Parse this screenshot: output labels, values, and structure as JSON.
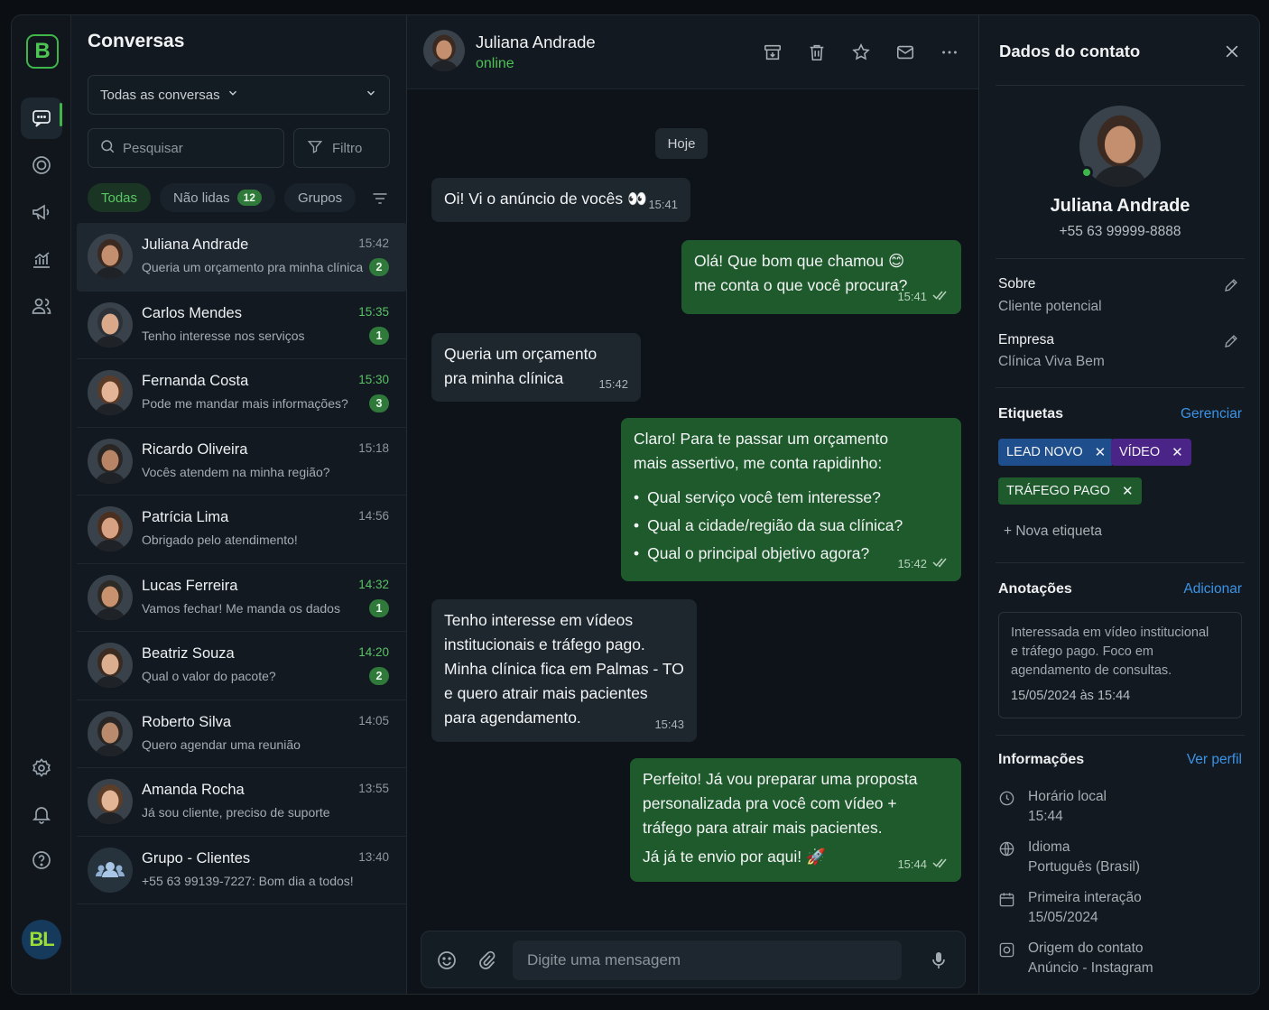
{
  "rail": {
    "logo": "B",
    "user_initials": "BL"
  },
  "list": {
    "title": "Conversas",
    "select_value": "Todas as conversas",
    "search_placeholder": "Pesquisar",
    "filter_label": "Filtro",
    "tabs": [
      {
        "label": "Todas"
      },
      {
        "label": "Não lidas",
        "count": "12"
      },
      {
        "label": "Grupos"
      }
    ],
    "conversations": [
      {
        "name": "Juliana Andrade",
        "preview": "Queria um orçamento pra minha clínica",
        "time": "15:42",
        "badge": "2"
      },
      {
        "name": "Carlos Mendes",
        "preview": "Tenho interesse nos serviços",
        "time": "15:35",
        "badge": "1"
      },
      {
        "name": "Fernanda Costa",
        "preview": "Pode me mandar mais informações?",
        "time": "15:30",
        "badge": "3"
      },
      {
        "name": "Ricardo Oliveira",
        "preview": "Vocês atendem na minha região?",
        "time": "15:18",
        "badge": ""
      },
      {
        "name": "Patrícia Lima",
        "preview": "Obrigado pelo atendimento!",
        "time": "14:56",
        "badge": ""
      },
      {
        "name": "Lucas Ferreira",
        "preview": "Vamos fechar! Me manda os dados",
        "time": "14:32",
        "badge": "1"
      },
      {
        "name": "Beatriz Souza",
        "preview": "Qual o valor do pacote?",
        "time": "14:20",
        "badge": "2"
      },
      {
        "name": "Roberto Silva",
        "preview": "Quero agendar uma reunião",
        "time": "14:05",
        "badge": ""
      },
      {
        "name": "Amanda Rocha",
        "preview": "Já sou cliente, preciso de suporte",
        "time": "13:55",
        "badge": ""
      },
      {
        "name": "Grupo - Clientes",
        "preview": "+55 63 99139-7227: Bom dia a todos!",
        "time": "13:40",
        "badge": ""
      }
    ]
  },
  "chat": {
    "name": "Juliana Andrade",
    "status": "online",
    "day_label": "Hoje",
    "messages": [
      {
        "text": "Oi! Vi o anúncio de vocês 👀",
        "time": "15:41"
      },
      {
        "line1": "Olá! Que bom que chamou 😊",
        "line2": "me conta o que você procura?",
        "time": "15:41"
      },
      {
        "line1": "Queria um orçamento",
        "line2": "pra minha clínica",
        "time": "15:42"
      },
      {
        "line1": "Claro! Para te passar um orçamento",
        "line2": "mais assertivo, me conta rapidinho:",
        "bullets": [
          "Qual serviço você tem interesse?",
          "Qual a cidade/região da sua clínica?",
          "Qual o principal objetivo agora?"
        ],
        "time": "15:42"
      },
      {
        "lines": [
          "Tenho interesse em vídeos",
          "institucionais e tráfego pago.",
          "Minha clínica fica em Palmas - TO",
          "e quero atrair mais pacientes",
          "para agendamento."
        ],
        "time": "15:43"
      },
      {
        "lines": [
          "Perfeito! Já vou preparar uma proposta",
          "personalizada pra você com vídeo +",
          "tráfego para atrair mais pacientes."
        ],
        "extra": "Já já te envio por aqui! 🚀",
        "time": "15:44"
      }
    ],
    "composer_placeholder": "Digite uma mensagem"
  },
  "contact": {
    "title": "Dados do contato",
    "name": "Juliana Andrade",
    "phone": "+55 63 99999-8888",
    "about_label": "Sobre",
    "about_value": "Cliente potencial",
    "company_label": "Empresa",
    "company_value": "Clínica Viva Bem",
    "tags_label": "Etiquetas",
    "tags_action": "Gerenciar",
    "tags": [
      {
        "label": "LEAD NOVO",
        "color": "#1f4e8c"
      },
      {
        "label": "VÍDEO",
        "color": "#4a2486"
      },
      {
        "label": "TRÁFEGO PAGO",
        "color": "#1e5a2c"
      }
    ],
    "new_tag": "Nova etiqueta",
    "notes_label": "Anotações",
    "notes_action": "Adicionar",
    "note_lines": [
      "Interessada em vídeo institucional",
      "e tráfego pago. Foco em",
      "agendamento de consultas."
    ],
    "note_date": "15/05/2024 às 15:44",
    "info_label": "Informações",
    "info_action": "Ver perfil",
    "info": [
      {
        "label": "Horário local",
        "value": "15:44",
        "icon": "clock-icon"
      },
      {
        "label": "Idioma",
        "value": "Português (Brasil)",
        "icon": "globe-icon"
      },
      {
        "label": "Primeira interação",
        "value": "15/05/2024",
        "icon": "calendar-icon"
      },
      {
        "label": "Origem do contato",
        "value": "Anúncio - Instagram",
        "icon": "source-icon"
      }
    ]
  },
  "colors": {
    "accent": "#3fb64a",
    "link": "#3b93e6",
    "outgoing_bubble": "#1e5a2c",
    "incoming_bubble": "#1e272e"
  }
}
